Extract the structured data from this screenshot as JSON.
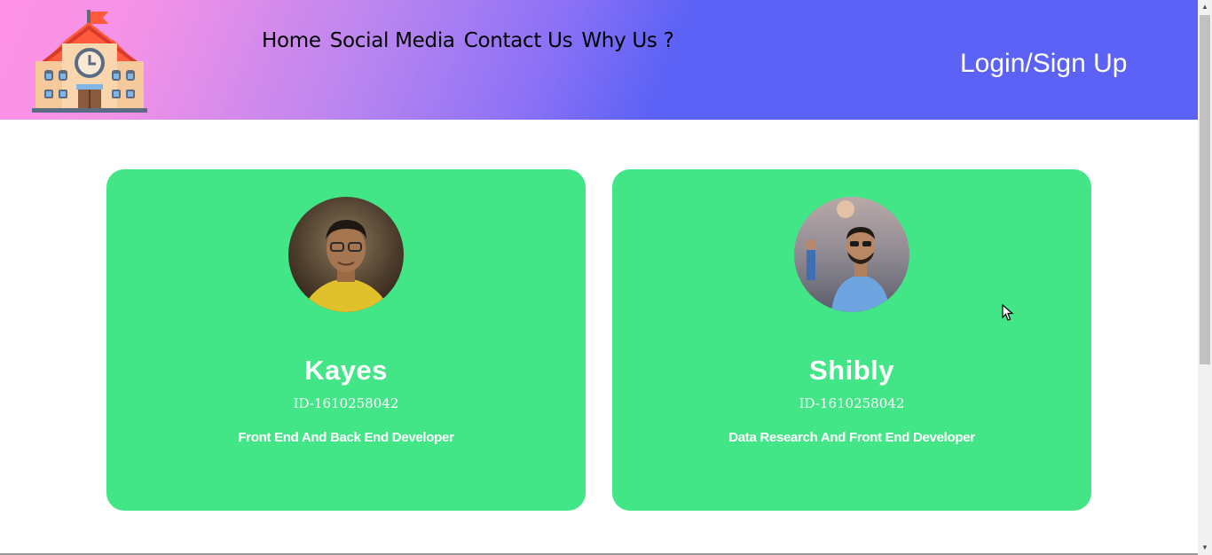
{
  "header": {
    "nav": [
      "Home",
      "Social Media",
      "Contact Us",
      "Why Us ?"
    ],
    "login_label": "Login/Sign Up",
    "logo_icon": "school-building-icon",
    "gradient_colors": [
      "#ff92e6",
      "#b784f0",
      "#5b62f5"
    ]
  },
  "cards": [
    {
      "name": "Kayes",
      "id_text": "ID-1610258042",
      "role": "Front End And Back End Developer",
      "avatar_icon": "profile-photo"
    },
    {
      "name": "Shibly",
      "id_text": "ID-1610258042",
      "role": "Data Research And Front End Developer",
      "avatar_icon": "profile-photo"
    }
  ],
  "colors": {
    "card_bg": "#43e687",
    "header_accent": "#5c62f5"
  }
}
